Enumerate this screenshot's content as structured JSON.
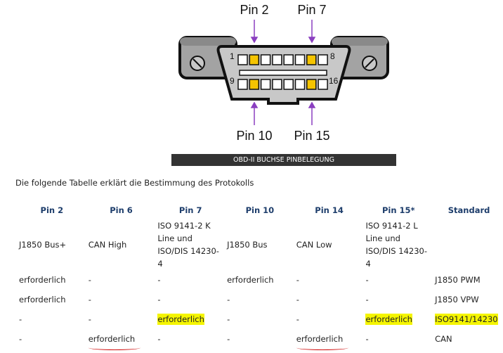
{
  "diagram": {
    "labels_top": [
      "Pin 2",
      "Pin 7"
    ],
    "labels_bottom": [
      "Pin 10",
      "Pin 15"
    ],
    "pin_numbers": [
      "1",
      "8",
      "9",
      "16"
    ],
    "highlight_color": "#f5c400",
    "arrow_color": "#8a3fc0"
  },
  "caption": "OBD-II BUCHSE PINBELEGUNG",
  "intro": "Die folgende Tabelle erklärt die Bestimmung des Protokolls",
  "table": {
    "headers": [
      "Pin 2",
      "Pin 6",
      "Pin 7",
      "Pin 10",
      "Pin 14",
      "Pin 15*",
      "Standard"
    ],
    "desc": [
      "J1850 Bus+",
      "CAN High",
      "ISO 9141-2 K Line und ISO/DIS 14230-4",
      "J1850 Bus",
      "CAN Low",
      "ISO 9141-2 L Line und ISO/DIS 14230-4",
      ""
    ],
    "rows": [
      [
        "erforderlich",
        "-",
        "-",
        "erforderlich",
        "-",
        "-",
        "J1850 PWM"
      ],
      [
        "erforderlich",
        "-",
        "-",
        "-",
        "-",
        "-",
        "J1850 VPW"
      ],
      [
        "-",
        "-",
        "erforderlich",
        "-",
        "-",
        "erforderlich",
        "ISO9141/14230"
      ],
      [
        "-",
        "erforderlich",
        "-",
        "-",
        "erforderlich",
        "-",
        "CAN"
      ]
    ],
    "highlighted": "#f5f500"
  }
}
